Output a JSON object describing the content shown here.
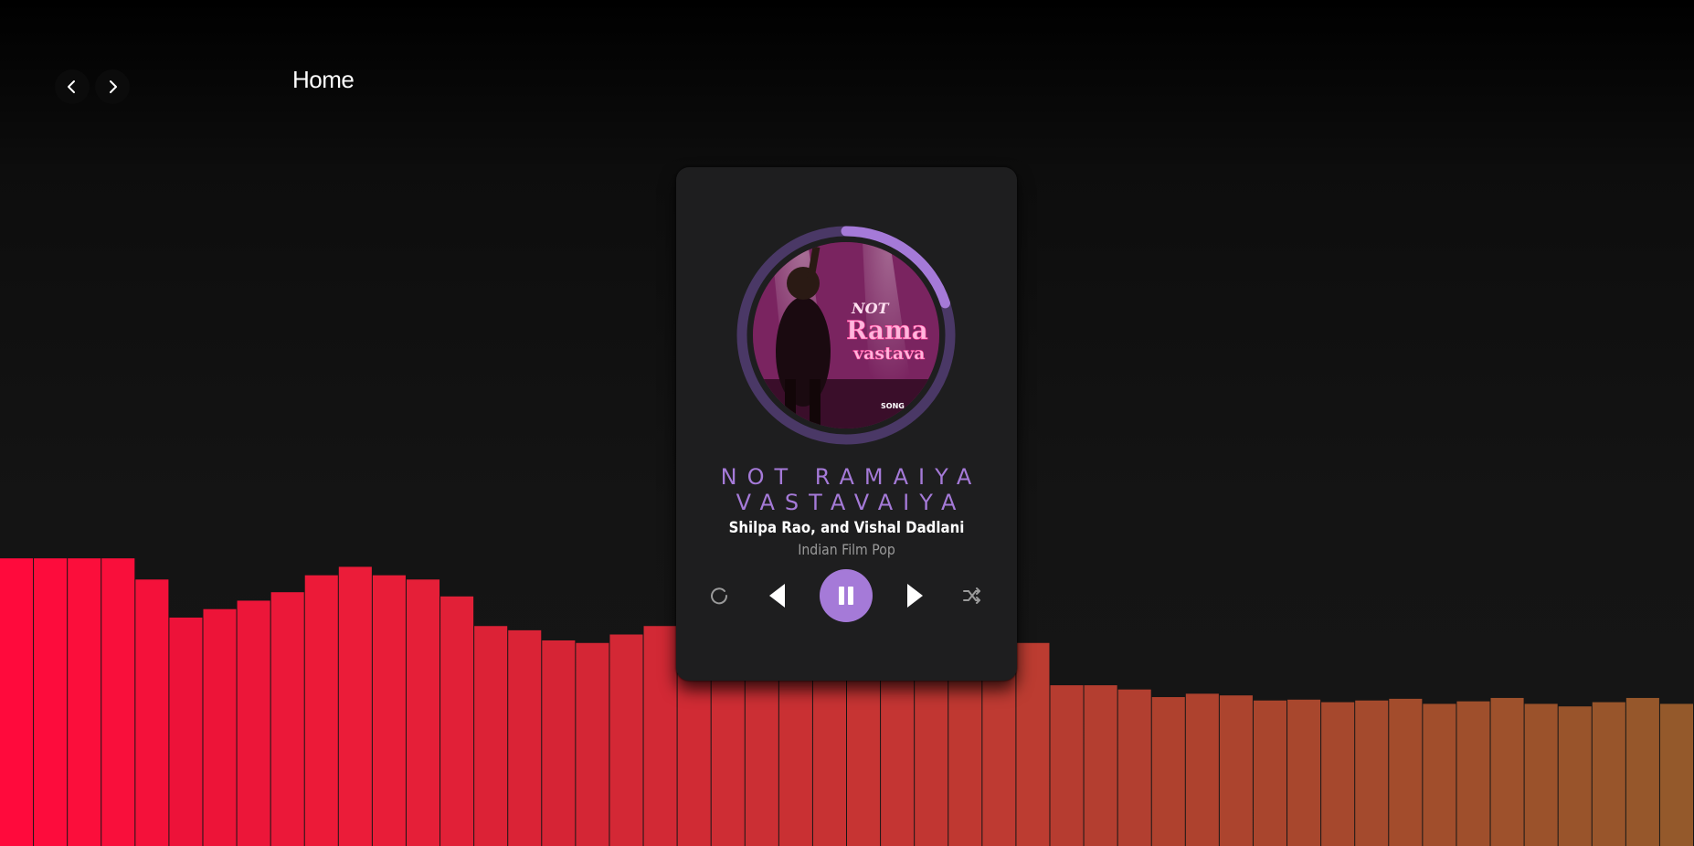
{
  "header": {
    "title": "Home",
    "back_icon": "chevron-left-icon",
    "forward_icon": "chevron-right-icon"
  },
  "player": {
    "track": {
      "title": "NOT RAMAIYA VASTAVAIYA",
      "artist": "Shilpa Rao, and Vishal Dadlani",
      "genre": "Indian Film Pop",
      "progress": 0.2,
      "album_art_text": {
        "line1": "NOT",
        "line2": "Rama",
        "line3": "vastava",
        "badge": "SONG"
      }
    },
    "controls": {
      "repeat_icon": "repeat-icon",
      "previous_icon": "previous-icon",
      "play_state": "playing",
      "pause_icon": "pause-icon",
      "next_icon": "next-icon",
      "shuffle_icon": "shuffle-icon"
    },
    "colors": {
      "accent": "#a57ad8",
      "ring_track": "#4a3866",
      "card_bg": "#1e1e1f"
    }
  },
  "visualizer": {
    "levels": [
      0.34,
      0.34,
      0.34,
      0.34,
      0.315,
      0.27,
      0.28,
      0.29,
      0.3,
      0.32,
      0.33,
      0.32,
      0.315,
      0.295,
      0.26,
      0.255,
      0.243,
      0.24,
      0.25,
      0.26,
      0.255,
      0.25,
      0.245,
      0.24,
      0.238,
      0.236,
      0.235,
      0.232,
      0.23,
      0.235,
      0.24,
      0.19,
      0.19,
      0.185,
      0.176,
      0.18,
      0.178,
      0.172,
      0.173,
      0.17,
      0.172,
      0.174,
      0.168,
      0.171,
      0.175,
      0.168,
      0.165,
      0.17,
      0.175,
      0.168
    ],
    "color_start": "#ff0a3c",
    "color_end": "#a0602e"
  }
}
